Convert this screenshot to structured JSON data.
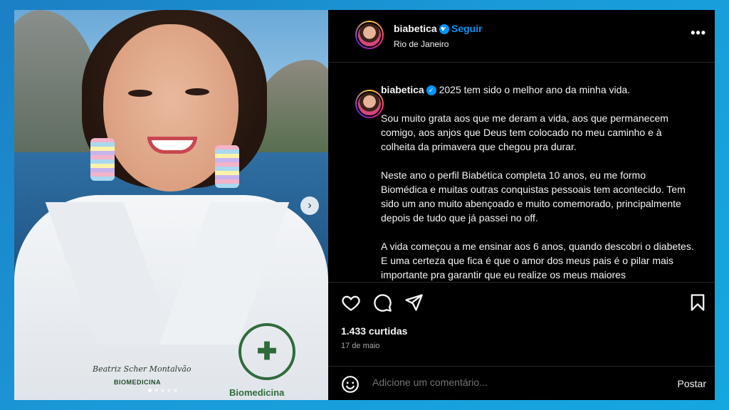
{
  "post": {
    "username": "biabetica",
    "follow_label": "Seguir",
    "separator": "•",
    "location": "Rio de Janeiro",
    "more_label": "•••",
    "caption_paragraphs": [
      "2025 tem sido o melhor ano da minha vida.",
      "Sou muito grata aos que me deram a vida, aos que permanecem comigo, aos anjos que Deus tem colocado no meu caminho e à colheita da primavera que chegou pra durar.",
      "Neste ano o perfil Biabética completa 10 anos, eu me formo Biomédica e muitas outras conquistas pessoais tem acontecido. Tem sido um ano muito abençoado e muito comemorado, principalmente depois de tudo que já passei no off.",
      "A vida começou a me ensinar aos 6 anos, quando descobri o diabetes. E uma certeza que fica é que o amor dos meus pais é o pilar mais importante pra garantir que eu realize os meus maiores"
    ],
    "likes": "1.433 curtidas",
    "date": "17 de maio",
    "comment_placeholder": "Adicione um comentário...",
    "post_label": "Postar"
  },
  "photo": {
    "badge_name": "Beatriz Scher Montalvão",
    "badge_course": "BIOMEDICINA",
    "patch_label": "Biomedicina",
    "next_icon": "›",
    "carousel_pages": 5,
    "carousel_active_index": 0
  },
  "icons": {
    "verified": "verified-badge-icon",
    "like": "heart-icon",
    "comment": "comment-icon",
    "share": "paper-plane-icon",
    "save": "bookmark-icon",
    "emoji": "emoji-smile-icon"
  },
  "colors": {
    "accent": "#0095f6",
    "background": "#000000",
    "frame_gradient_start": "#1b7fc4",
    "frame_gradient_end": "#15a7e0"
  }
}
